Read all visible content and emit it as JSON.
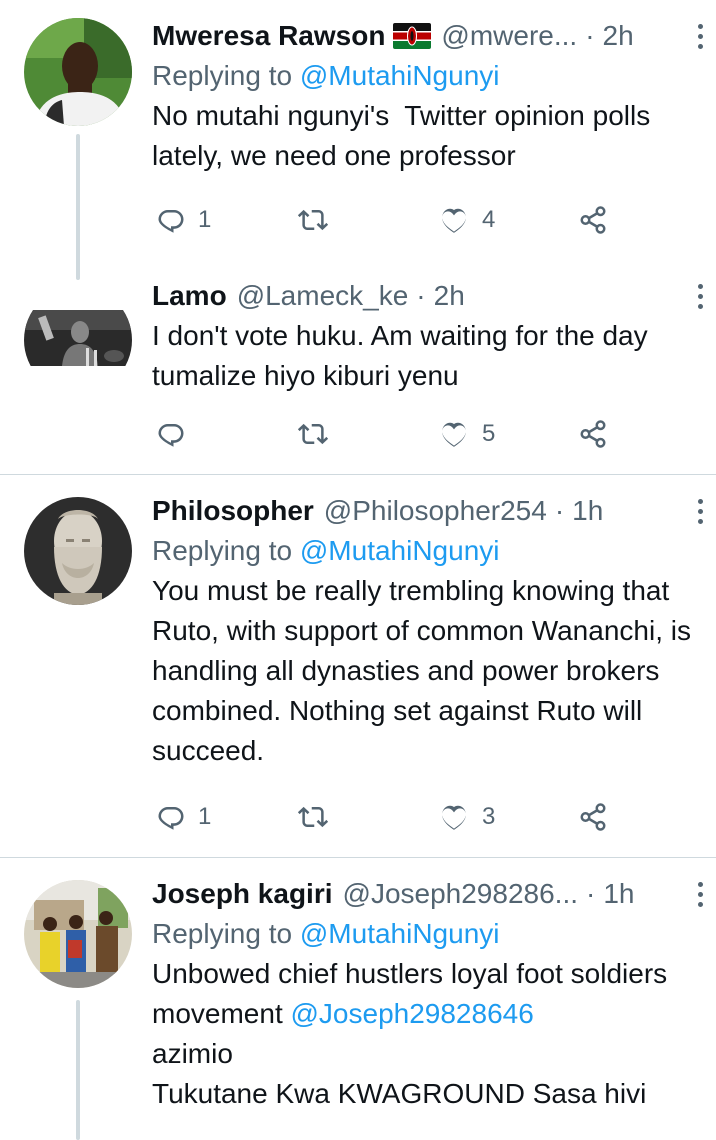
{
  "tweets": [
    {
      "name": "Mweresa Rawson",
      "handle": "@mwere...",
      "time": "2h",
      "replying_label": "Replying to",
      "replying_to": "@MutahiNgunyi",
      "text": "No mutahi ngunyi's  Twitter opinion polls lately, we need one professor",
      "reply_count": "1",
      "retweet_count": "",
      "like_count": "4"
    },
    {
      "name": "Lamo",
      "handle": "@Lameck_ke",
      "time": "2h",
      "text": "I don't vote huku. Am waiting for the day tumalize hiyo kiburi yenu",
      "reply_count": "",
      "retweet_count": "",
      "like_count": "5"
    },
    {
      "name": "Philosopher",
      "handle": "@Philosopher254",
      "time": "1h",
      "replying_label": "Replying to",
      "replying_to": "@MutahiNgunyi",
      "text": "You must be really trembling knowing that Ruto, with support of common Wananchi, is handling all dynasties and power brokers combined. Nothing set against Ruto will succeed.",
      "reply_count": "1",
      "retweet_count": "",
      "like_count": "3"
    },
    {
      "name": "Joseph kagiri",
      "handle": "@Joseph298286...",
      "time": "1h",
      "replying_label": "Replying to",
      "replying_to": "@MutahiNgunyi",
      "text_1": "Unbowed chief hustlers loyal foot soldiers  movement ",
      "text_mention": "@Joseph29828646",
      "text_2": "azimio\nTukutane Kwa KWAGROUND Sasa hivi"
    }
  ],
  "separator": "·",
  "colors": {
    "text": "#0f1419",
    "secondary": "#536471",
    "link": "#1d9bf0",
    "divider": "#cfd9de"
  },
  "icons": [
    "reply-icon",
    "retweet-icon",
    "like-icon",
    "share-icon",
    "more-options-icon",
    "kenya-flag-icon"
  ]
}
